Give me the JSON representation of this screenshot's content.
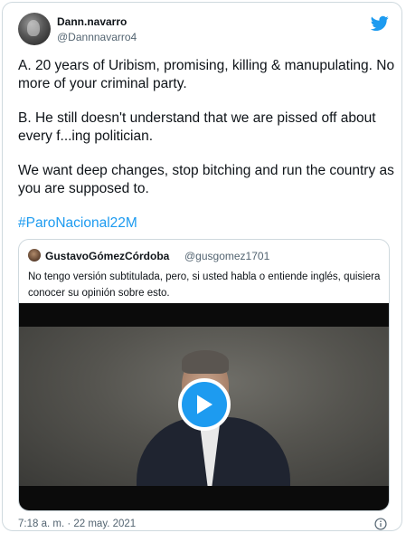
{
  "author": {
    "name": "Dann.navarro",
    "handle": "@Dannnavarro4"
  },
  "tweet": {
    "para_a": "A. 20 years of Uribism, promising, killing & manupulating. No more of your criminal party.",
    "para_b": "B. He still doesn't understand that we are pissed off about every f...ing politician.",
    "para_c": "We want deep changes, stop bitching and run the country as you are supposed to.",
    "hashtag": "#ParoNacional22M",
    "timestamp": "7:18 a. m. · 22 may. 2021"
  },
  "quoted_tweet": {
    "name": "GustavoGómezCórdoba",
    "handle": "@gusgomez1701",
    "text": "No tengo versión subtitulada, pero, si usted habla o entiende inglés, quisiera conocer su opinión sobre esto."
  },
  "icons": {
    "logo": "twitter-bird-icon",
    "play": "play-icon",
    "info": "info-icon"
  },
  "colors": {
    "accent": "#1d9bf0",
    "text": "#0f1419",
    "muted": "#536471",
    "border": "#cfd9de"
  }
}
